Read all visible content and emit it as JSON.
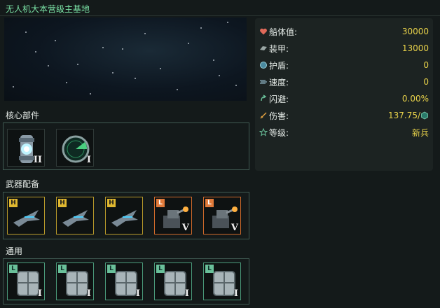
{
  "title": "无人机大本营级主基地",
  "stats": [
    {
      "icon": "heart-icon",
      "label": "船体值:",
      "value": "30000"
    },
    {
      "icon": "armor-icon",
      "label": "装甲:",
      "value": "13000"
    },
    {
      "icon": "shield-icon",
      "label": "护盾:",
      "value": "0"
    },
    {
      "icon": "speed-icon",
      "label": "速度:",
      "value": "0"
    },
    {
      "icon": "evade-icon",
      "label": "闪避:",
      "value": "0.00%"
    },
    {
      "icon": "damage-icon",
      "label": "伤害:",
      "value": "137.75/"
    },
    {
      "icon": "star-icon",
      "label": "等级:",
      "value": "新兵"
    }
  ],
  "sections": {
    "core": "核心部件",
    "weapons": "武器配备",
    "general": "通用"
  },
  "core_parts": [
    {
      "icon": "power-core-icon",
      "level": "II"
    },
    {
      "icon": "radar-icon",
      "level": "I"
    }
  ],
  "weapons": [
    {
      "badge": "H",
      "icon": "fighter-icon",
      "level": ""
    },
    {
      "badge": "H",
      "icon": "fighter-icon",
      "level": ""
    },
    {
      "badge": "H",
      "icon": "fighter-icon",
      "level": ""
    },
    {
      "badge": "L",
      "icon": "turret-icon",
      "level": "V"
    },
    {
      "badge": "L",
      "icon": "turret-icon",
      "level": "V"
    }
  ],
  "general": [
    {
      "badge": "L",
      "icon": "armor-plate-icon",
      "level": "I"
    },
    {
      "badge": "L",
      "icon": "armor-plate-icon",
      "level": "I"
    },
    {
      "badge": "L",
      "icon": "armor-plate-icon",
      "level": "I"
    },
    {
      "badge": "L",
      "icon": "armor-plate-icon",
      "level": "I"
    },
    {
      "badge": "L",
      "icon": "armor-plate-icon",
      "level": "I"
    }
  ],
  "colors": {
    "title": "#7be3a6",
    "value": "#e8d24a",
    "heavy": "#e0b830",
    "light": "#e07a3a",
    "utility": "#6ac09a"
  }
}
